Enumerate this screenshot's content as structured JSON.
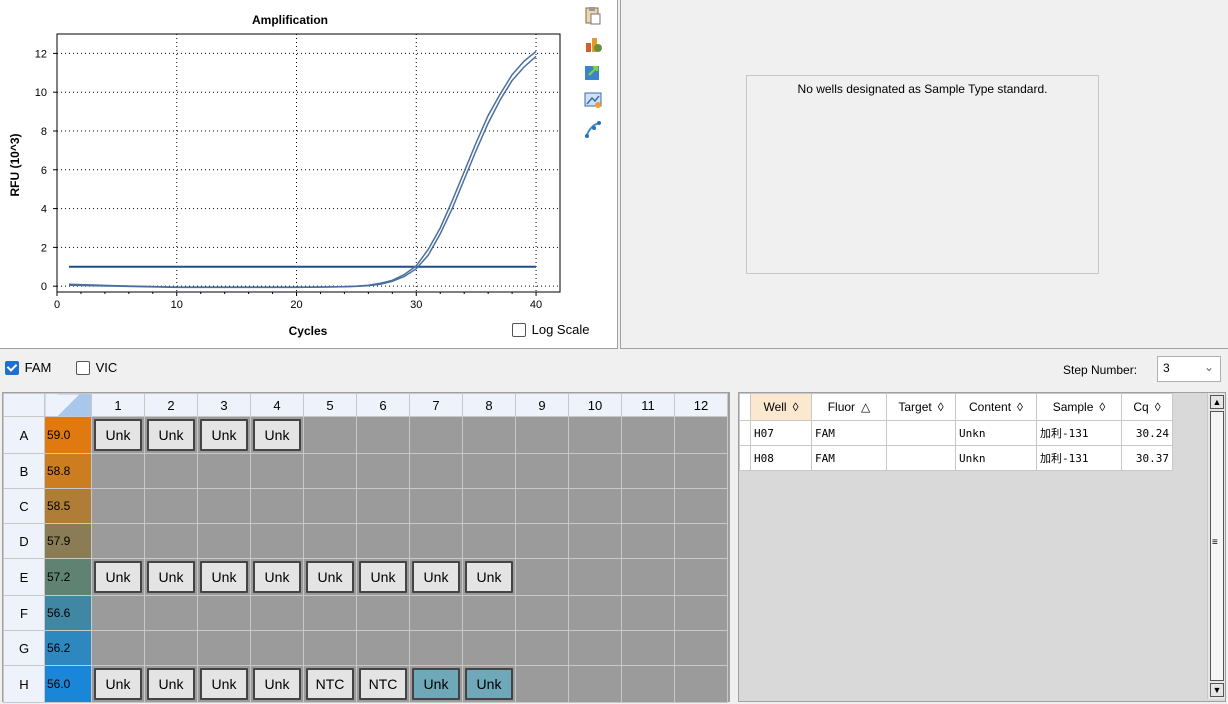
{
  "chart_data": {
    "type": "line",
    "title": "Amplification",
    "xlabel": "Cycles",
    "ylabel": "RFU (10^3)",
    "xlim": [
      0,
      42
    ],
    "ylim": [
      -0.3,
      13
    ],
    "xticks": [
      0,
      10,
      20,
      30,
      40
    ],
    "yticks": [
      0,
      2,
      4,
      6,
      8,
      10,
      12
    ],
    "grid": true,
    "threshold": 1.0,
    "series": [
      {
        "x": [
          1,
          5,
          10,
          15,
          20,
          22,
          24,
          25,
          26,
          27,
          28,
          29,
          30,
          31,
          32,
          33,
          34,
          35,
          36,
          37,
          38,
          39,
          40
        ],
        "y": [
          0.1,
          0.02,
          -0.05,
          -0.05,
          -0.05,
          -0.04,
          -0.02,
          0.0,
          0.05,
          0.15,
          0.3,
          0.6,
          1.05,
          1.9,
          3.0,
          4.4,
          5.9,
          7.4,
          8.8,
          9.9,
          10.9,
          11.6,
          12.1
        ]
      },
      {
        "x": [
          1,
          5,
          10,
          15,
          20,
          22,
          24,
          25,
          26,
          27,
          28,
          29,
          30,
          31,
          32,
          33,
          34,
          35,
          36,
          37,
          38,
          39,
          40
        ],
        "y": [
          0.05,
          0.0,
          -0.06,
          -0.06,
          -0.06,
          -0.05,
          -0.03,
          -0.01,
          0.03,
          0.1,
          0.25,
          0.5,
          0.9,
          1.6,
          2.7,
          4.0,
          5.5,
          7.0,
          8.4,
          9.6,
          10.6,
          11.3,
          11.85
        ]
      }
    ],
    "colors": {
      "line": "#4a6f9e",
      "threshold": "#1f4e8c"
    }
  },
  "chart_options": {
    "log_scale_label": "Log Scale",
    "log_scale_checked": false
  },
  "toolbar_icons": [
    "clipboard-icon",
    "chart-settings-icon",
    "export-icon",
    "image-icon",
    "curve-icon"
  ],
  "standard_curve": {
    "message": "No wells designated as Sample Type standard."
  },
  "fluors": [
    {
      "label": "FAM",
      "checked": true
    },
    {
      "label": "VIC",
      "checked": false
    }
  ],
  "step": {
    "label": "Step Number:",
    "value": "3"
  },
  "plate": {
    "columns": [
      "1",
      "2",
      "3",
      "4",
      "5",
      "6",
      "7",
      "8",
      "9",
      "10",
      "11",
      "12"
    ],
    "rows": [
      {
        "label": "A",
        "temp": "59.0",
        "color": "#e07a10",
        "wells": [
          "Unk",
          "Unk",
          "Unk",
          "Unk",
          "",
          "",
          "",
          "",
          "",
          "",
          "",
          ""
        ]
      },
      {
        "label": "B",
        "temp": "58.8",
        "color": "#cc7d1f",
        "wells": [
          "",
          "",
          "",
          "",
          "",
          "",
          "",
          "",
          "",
          "",
          "",
          ""
        ]
      },
      {
        "label": "C",
        "temp": "58.5",
        "color": "#b07d36",
        "wells": [
          "",
          "",
          "",
          "",
          "",
          "",
          "",
          "",
          "",
          "",
          "",
          ""
        ]
      },
      {
        "label": "D",
        "temp": "57.9",
        "color": "#8a7d55",
        "wells": [
          "",
          "",
          "",
          "",
          "",
          "",
          "",
          "",
          "",
          "",
          "",
          ""
        ]
      },
      {
        "label": "E",
        "temp": "57.2",
        "color": "#5f8272",
        "wells": [
          "Unk",
          "Unk",
          "Unk",
          "Unk",
          "Unk",
          "Unk",
          "Unk",
          "Unk",
          "",
          "",
          "",
          ""
        ]
      },
      {
        "label": "F",
        "temp": "56.6",
        "color": "#3f87a3",
        "wells": [
          "",
          "",
          "",
          "",
          "",
          "",
          "",
          "",
          "",
          "",
          "",
          ""
        ]
      },
      {
        "label": "G",
        "temp": "56.2",
        "color": "#2e88c0",
        "wells": [
          "",
          "",
          "",
          "",
          "",
          "",
          "",
          "",
          "",
          "",
          "",
          ""
        ]
      },
      {
        "label": "H",
        "temp": "56.0",
        "color": "#1a86d8",
        "wells": [
          "Unk",
          "Unk",
          "Unk",
          "Unk",
          "NTC",
          "NTC",
          "Unk",
          "Unk",
          "",
          "",
          "",
          ""
        ],
        "selected": [
          6,
          7
        ]
      }
    ]
  },
  "results": {
    "columns": [
      {
        "label": "Well",
        "sort": "◊"
      },
      {
        "label": "Fluor",
        "sort": "△"
      },
      {
        "label": "Target",
        "sort": "◊"
      },
      {
        "label": "Content",
        "sort": "◊"
      },
      {
        "label": "Sample",
        "sort": "◊"
      },
      {
        "label": "Cq",
        "sort": "◊"
      }
    ],
    "rows": [
      [
        "H07",
        "FAM",
        "",
        "Unkn",
        "加利-131",
        "30.24"
      ],
      [
        "H08",
        "FAM",
        "",
        "Unkn",
        "加利-131",
        "30.37"
      ]
    ]
  }
}
